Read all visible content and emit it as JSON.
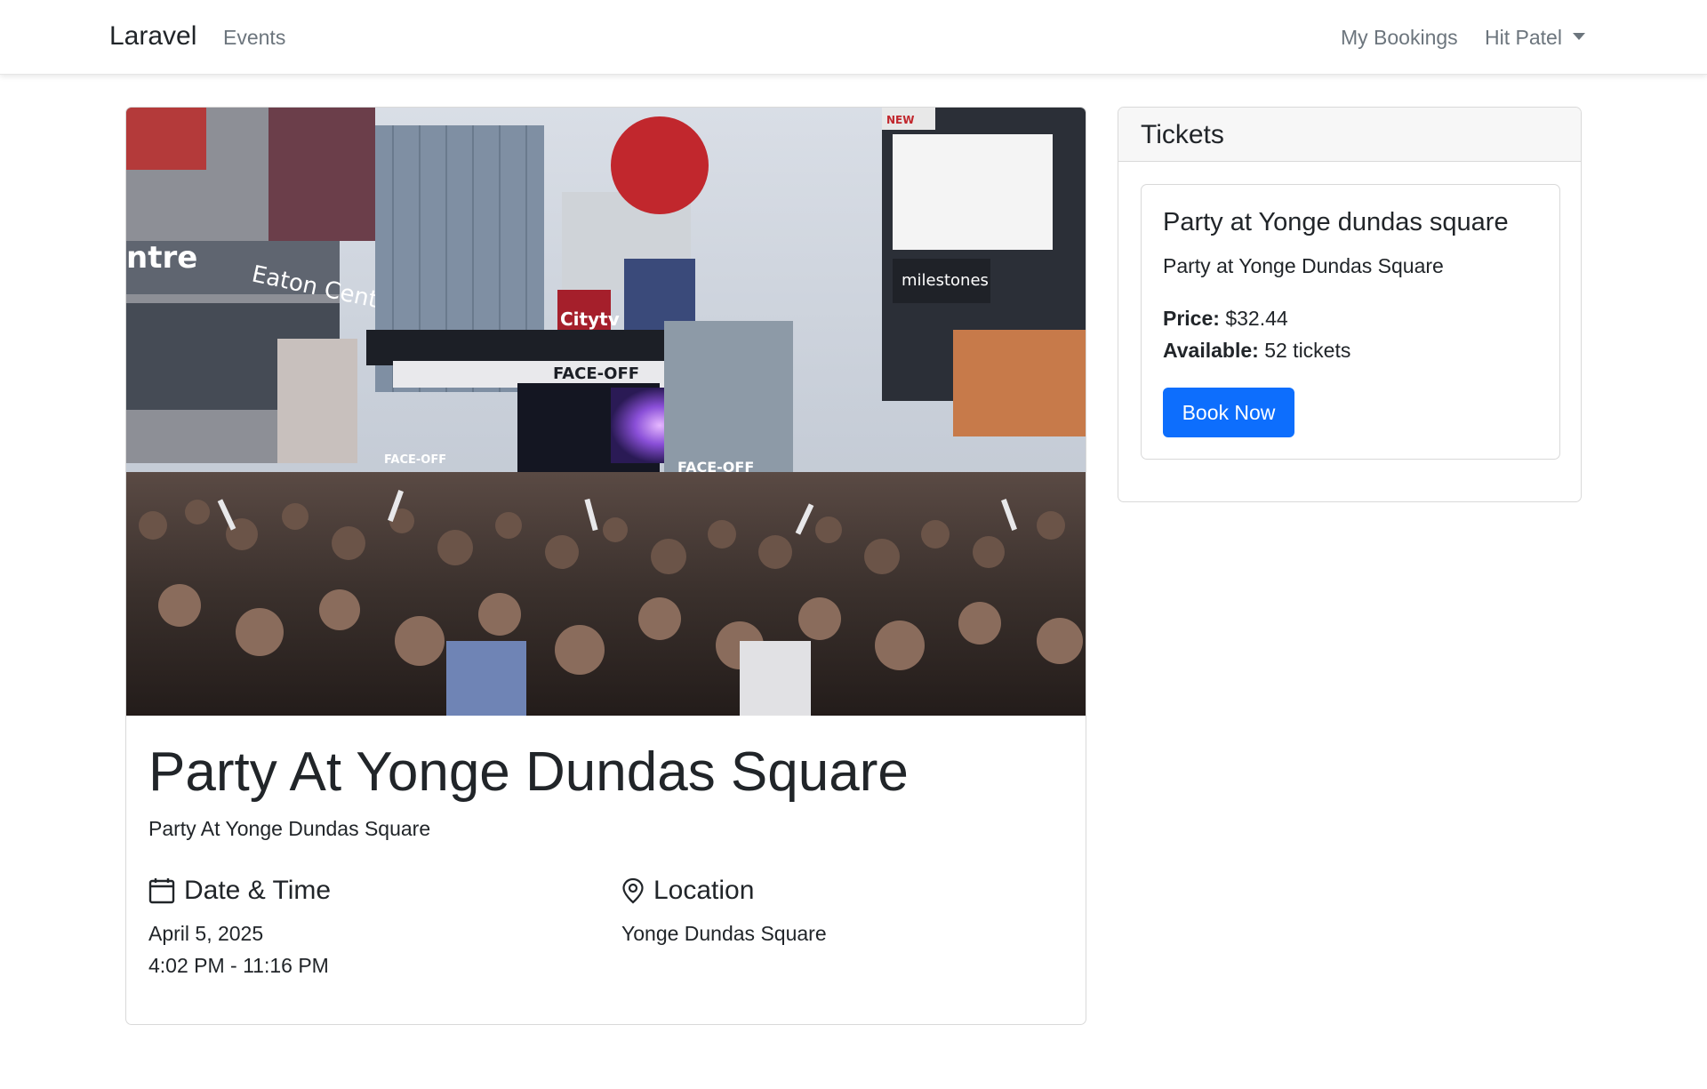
{
  "navbar": {
    "brand": "Laravel",
    "links": {
      "events": "Events",
      "my_bookings": "My Bookings",
      "user": "Hit Patel"
    }
  },
  "event": {
    "title": "Party At Yonge Dundas Square",
    "subtitle": "Party At Yonge Dundas Square",
    "date_time": {
      "heading": "Date & Time",
      "date": "April 5, 2025",
      "time": "4:02 PM - 11:16 PM"
    },
    "location": {
      "heading": "Location",
      "value": "Yonge Dundas Square"
    },
    "image": {
      "signage": [
        "entre",
        "Eaton Centre",
        "FACE-OFF",
        "FACE-OFF",
        "FACE-OFF",
        "milestones",
        "Citytv",
        "NEW"
      ]
    }
  },
  "tickets": {
    "heading": "Tickets",
    "items": [
      {
        "name": "Party at Yonge dundas square",
        "description": "Party at Yonge Dundas Square",
        "price_label": "Price:",
        "price": "$32.44",
        "available_label": "Available:",
        "available": "52 tickets",
        "button": "Book Now"
      }
    ]
  },
  "colors": {
    "primary": "#0d6efd",
    "text": "#212529",
    "muted": "#6c757d",
    "border": "#d9d9d9"
  },
  "icons": {
    "date": "calendar-icon",
    "location": "map-pin-icon",
    "user_dropdown": "caret-down-icon"
  }
}
